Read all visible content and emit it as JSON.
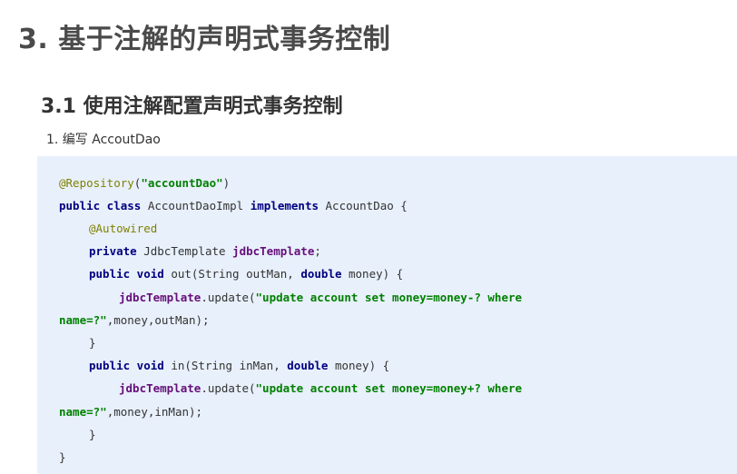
{
  "heading_main": "3. 基于注解的声明式事务控制",
  "heading_sub": "3.1 使用注解配置声明式事务控制",
  "step_1": "1. 编写 AccoutDao",
  "code": {
    "l1_ann": "@Repository",
    "l1_open": "(",
    "l1_str": "\"accountDao\"",
    "l1_close": ")",
    "l2_kw1": "public class",
    "l2_t1": " AccountDaoImpl ",
    "l2_kw2": "implements",
    "l2_t2": " AccountDao {",
    "l3_ann": "@Autowired",
    "l4_kw": "private",
    "l4_t1": " JdbcTemplate ",
    "l4_fld": "jdbcTemplate",
    "l4_t2": ";",
    "l5_kw1": "public void",
    "l5_t1": " out(String outMan, ",
    "l5_kw2": "double",
    "l5_t2": " money) {",
    "l6_fld": "jdbcTemplate",
    "l6_t1": ".update(",
    "l6_str": "\"update account set money=money-? where",
    "l7_str": "name=?\"",
    "l7_t1": ",money,outMan);",
    "l8_t": "}",
    "l9_kw1": "public void",
    "l9_t1": " in(String inMan, ",
    "l9_kw2": "double",
    "l9_t2": " money) {",
    "l10_fld": "jdbcTemplate",
    "l10_t1": ".update(",
    "l10_str": "\"update account set money=money+? where",
    "l11_str": "name=?\"",
    "l11_t1": ",money,inMan);",
    "l12_t": "}",
    "l13_t": "}"
  }
}
